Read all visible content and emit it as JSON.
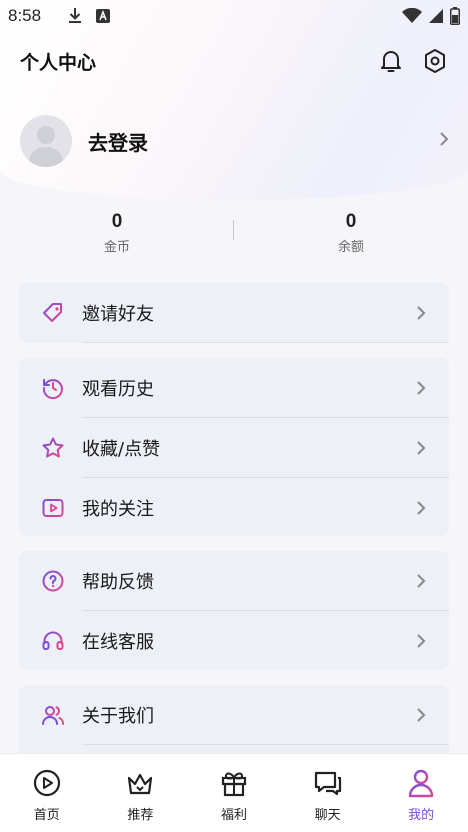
{
  "status_bar": {
    "time": "8:58"
  },
  "header": {
    "title": "个人中心"
  },
  "profile": {
    "login_label": "去登录"
  },
  "stats": [
    {
      "value": "0",
      "label": "金币"
    },
    {
      "value": "0",
      "label": "余额"
    }
  ],
  "menu_groups": [
    {
      "items": [
        {
          "label": "邀请好友",
          "icon": "tag-icon"
        }
      ]
    },
    {
      "items": [
        {
          "label": "观看历史",
          "icon": "history-icon"
        },
        {
          "label": "收藏/点赞",
          "icon": "star-icon"
        },
        {
          "label": "我的关注",
          "icon": "play-square-icon"
        }
      ]
    },
    {
      "items": [
        {
          "label": "帮助反馈",
          "icon": "help-circle-icon"
        },
        {
          "label": "在线客服",
          "icon": "headset-icon"
        }
      ]
    },
    {
      "items": [
        {
          "label": "关于我们",
          "icon": "users-icon"
        }
      ]
    }
  ],
  "tabbar": {
    "tabs": [
      {
        "label": "首页",
        "icon": "play-circle-icon"
      },
      {
        "label": "推荐",
        "icon": "crown-icon"
      },
      {
        "label": "福利",
        "icon": "gift-icon"
      },
      {
        "label": "聊天",
        "icon": "chat-icon"
      },
      {
        "label": "我的",
        "icon": "user-icon",
        "active": true
      }
    ]
  },
  "colors": {
    "accent": "#7b4fd9",
    "accent_pink": "#e0468e",
    "card_bg": "#eef0f8"
  }
}
